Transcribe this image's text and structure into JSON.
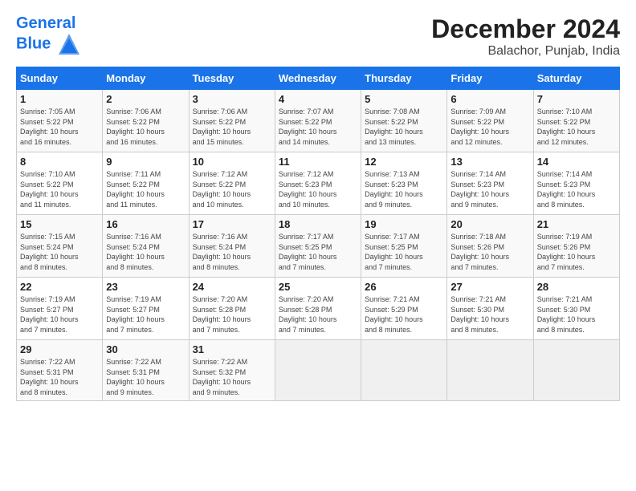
{
  "header": {
    "logo_line1": "General",
    "logo_line2": "Blue",
    "title": "December 2024",
    "subtitle": "Balachor, Punjab, India"
  },
  "columns": [
    "Sunday",
    "Monday",
    "Tuesday",
    "Wednesday",
    "Thursday",
    "Friday",
    "Saturday"
  ],
  "weeks": [
    [
      {
        "day": "1",
        "info": "Sunrise: 7:05 AM\nSunset: 5:22 PM\nDaylight: 10 hours\nand 16 minutes."
      },
      {
        "day": "2",
        "info": "Sunrise: 7:06 AM\nSunset: 5:22 PM\nDaylight: 10 hours\nand 16 minutes."
      },
      {
        "day": "3",
        "info": "Sunrise: 7:06 AM\nSunset: 5:22 PM\nDaylight: 10 hours\nand 15 minutes."
      },
      {
        "day": "4",
        "info": "Sunrise: 7:07 AM\nSunset: 5:22 PM\nDaylight: 10 hours\nand 14 minutes."
      },
      {
        "day": "5",
        "info": "Sunrise: 7:08 AM\nSunset: 5:22 PM\nDaylight: 10 hours\nand 13 minutes."
      },
      {
        "day": "6",
        "info": "Sunrise: 7:09 AM\nSunset: 5:22 PM\nDaylight: 10 hours\nand 12 minutes."
      },
      {
        "day": "7",
        "info": "Sunrise: 7:10 AM\nSunset: 5:22 PM\nDaylight: 10 hours\nand 12 minutes."
      }
    ],
    [
      {
        "day": "8",
        "info": "Sunrise: 7:10 AM\nSunset: 5:22 PM\nDaylight: 10 hours\nand 11 minutes."
      },
      {
        "day": "9",
        "info": "Sunrise: 7:11 AM\nSunset: 5:22 PM\nDaylight: 10 hours\nand 11 minutes."
      },
      {
        "day": "10",
        "info": "Sunrise: 7:12 AM\nSunset: 5:22 PM\nDaylight: 10 hours\nand 10 minutes."
      },
      {
        "day": "11",
        "info": "Sunrise: 7:12 AM\nSunset: 5:23 PM\nDaylight: 10 hours\nand 10 minutes."
      },
      {
        "day": "12",
        "info": "Sunrise: 7:13 AM\nSunset: 5:23 PM\nDaylight: 10 hours\nand 9 minutes."
      },
      {
        "day": "13",
        "info": "Sunrise: 7:14 AM\nSunset: 5:23 PM\nDaylight: 10 hours\nand 9 minutes."
      },
      {
        "day": "14",
        "info": "Sunrise: 7:14 AM\nSunset: 5:23 PM\nDaylight: 10 hours\nand 8 minutes."
      }
    ],
    [
      {
        "day": "15",
        "info": "Sunrise: 7:15 AM\nSunset: 5:24 PM\nDaylight: 10 hours\nand 8 minutes."
      },
      {
        "day": "16",
        "info": "Sunrise: 7:16 AM\nSunset: 5:24 PM\nDaylight: 10 hours\nand 8 minutes."
      },
      {
        "day": "17",
        "info": "Sunrise: 7:16 AM\nSunset: 5:24 PM\nDaylight: 10 hours\nand 8 minutes."
      },
      {
        "day": "18",
        "info": "Sunrise: 7:17 AM\nSunset: 5:25 PM\nDaylight: 10 hours\nand 7 minutes."
      },
      {
        "day": "19",
        "info": "Sunrise: 7:17 AM\nSunset: 5:25 PM\nDaylight: 10 hours\nand 7 minutes."
      },
      {
        "day": "20",
        "info": "Sunrise: 7:18 AM\nSunset: 5:26 PM\nDaylight: 10 hours\nand 7 minutes."
      },
      {
        "day": "21",
        "info": "Sunrise: 7:19 AM\nSunset: 5:26 PM\nDaylight: 10 hours\nand 7 minutes."
      }
    ],
    [
      {
        "day": "22",
        "info": "Sunrise: 7:19 AM\nSunset: 5:27 PM\nDaylight: 10 hours\nand 7 minutes."
      },
      {
        "day": "23",
        "info": "Sunrise: 7:19 AM\nSunset: 5:27 PM\nDaylight: 10 hours\nand 7 minutes."
      },
      {
        "day": "24",
        "info": "Sunrise: 7:20 AM\nSunset: 5:28 PM\nDaylight: 10 hours\nand 7 minutes."
      },
      {
        "day": "25",
        "info": "Sunrise: 7:20 AM\nSunset: 5:28 PM\nDaylight: 10 hours\nand 7 minutes."
      },
      {
        "day": "26",
        "info": "Sunrise: 7:21 AM\nSunset: 5:29 PM\nDaylight: 10 hours\nand 8 minutes."
      },
      {
        "day": "27",
        "info": "Sunrise: 7:21 AM\nSunset: 5:30 PM\nDaylight: 10 hours\nand 8 minutes."
      },
      {
        "day": "28",
        "info": "Sunrise: 7:21 AM\nSunset: 5:30 PM\nDaylight: 10 hours\nand 8 minutes."
      }
    ],
    [
      {
        "day": "29",
        "info": "Sunrise: 7:22 AM\nSunset: 5:31 PM\nDaylight: 10 hours\nand 8 minutes."
      },
      {
        "day": "30",
        "info": "Sunrise: 7:22 AM\nSunset: 5:31 PM\nDaylight: 10 hours\nand 9 minutes."
      },
      {
        "day": "31",
        "info": "Sunrise: 7:22 AM\nSunset: 5:32 PM\nDaylight: 10 hours\nand 9 minutes."
      },
      {
        "day": "",
        "info": ""
      },
      {
        "day": "",
        "info": ""
      },
      {
        "day": "",
        "info": ""
      },
      {
        "day": "",
        "info": ""
      }
    ]
  ]
}
